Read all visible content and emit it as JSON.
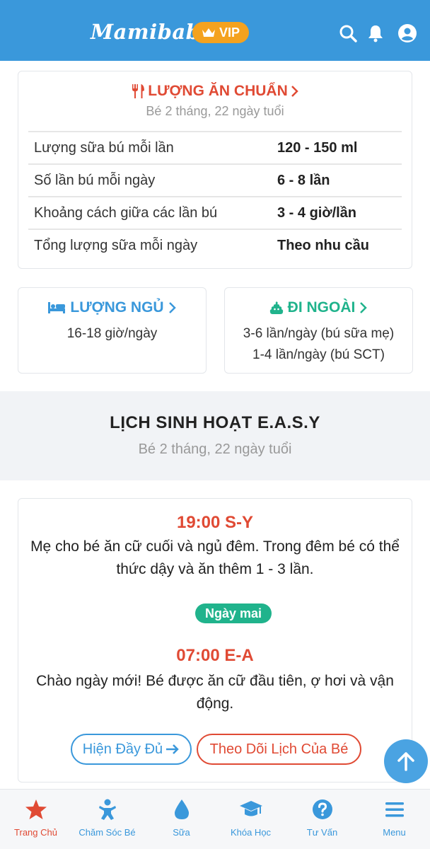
{
  "header": {
    "logo": "Mamibabi",
    "vip": "VIP"
  },
  "feeding": {
    "title": "LƯỢNG ĂN CHUẨN",
    "subtitle": "Bé 2 tháng, 22 ngày tuổi",
    "rows": [
      {
        "label": "Lượng sữa bú mỗi lần",
        "value": "120 - 150 ml"
      },
      {
        "label": "Số lần bú mỗi ngày",
        "value": "6 - 8 lần"
      },
      {
        "label": "Khoảng cách giữa các lần bú",
        "value": "3 - 4 giờ/lần"
      },
      {
        "label": "Tổng lượng sữa mỗi ngày",
        "value": "Theo nhu cầu"
      }
    ]
  },
  "sleep": {
    "title": "LƯỢNG NGỦ",
    "value": "16-18 giờ/ngày"
  },
  "poop": {
    "title": "ĐI NGOÀI",
    "line1": "3-6 lần/ngày (bú sữa mẹ)",
    "line2": "1-4 lần/ngày (bú SCT)"
  },
  "schedule": {
    "title": "LỊCH SINH HOẠT E.A.S.Y",
    "subtitle": "Bé 2 tháng, 22 ngày tuổi",
    "event1_time": "19:00 S-Y",
    "event1_text": "Mẹ cho bé ăn cữ cuối và ngủ đêm. Trong đêm bé có thể thức dậy và ăn thêm 1 - 3 lần.",
    "badge": "Ngày mai",
    "event2_time": "07:00 E-A",
    "event2_text": "Chào ngày mới! Bé được ăn cữ đầu tiên, ợ hơi và vận động.",
    "btn_full": "Hiện Đầy Đủ",
    "btn_track": "Theo Dõi Lịch Của Bé"
  },
  "nav": [
    {
      "label": "Trang Chủ",
      "icon": "star-icon"
    },
    {
      "label": "Chăm Sóc Bé",
      "icon": "baby-icon"
    },
    {
      "label": "Sữa",
      "icon": "drop-icon"
    },
    {
      "label": "Khóa Học",
      "icon": "graduation-cap-icon"
    },
    {
      "label": "Tư Vấn",
      "icon": "question-icon"
    },
    {
      "label": "Menu",
      "icon": "menu-icon"
    }
  ],
  "colors": {
    "primary": "#3a98db",
    "accent_red": "#e04a34",
    "green": "#20b38c",
    "vip": "#f4a21f"
  }
}
